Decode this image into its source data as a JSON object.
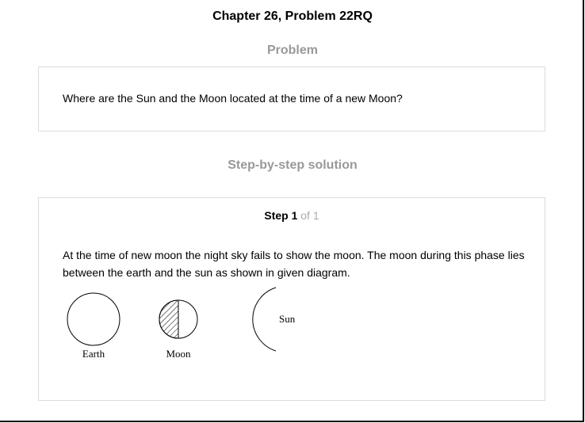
{
  "header": {
    "title": "Chapter 26, Problem 22RQ"
  },
  "problem": {
    "heading": "Problem",
    "text": "Where are the Sun and the Moon located at the time of a new Moon?"
  },
  "solution": {
    "heading": "Step-by-step solution",
    "step_label": "Step 1",
    "step_of": "of 1",
    "text": "At the time of new moon the night sky fails to show the moon. The moon during this phase lies between the earth and the sun as shown in given diagram.",
    "diagram": {
      "earth_label": "Earth",
      "moon_label": "Moon",
      "sun_label": "Sun"
    }
  }
}
